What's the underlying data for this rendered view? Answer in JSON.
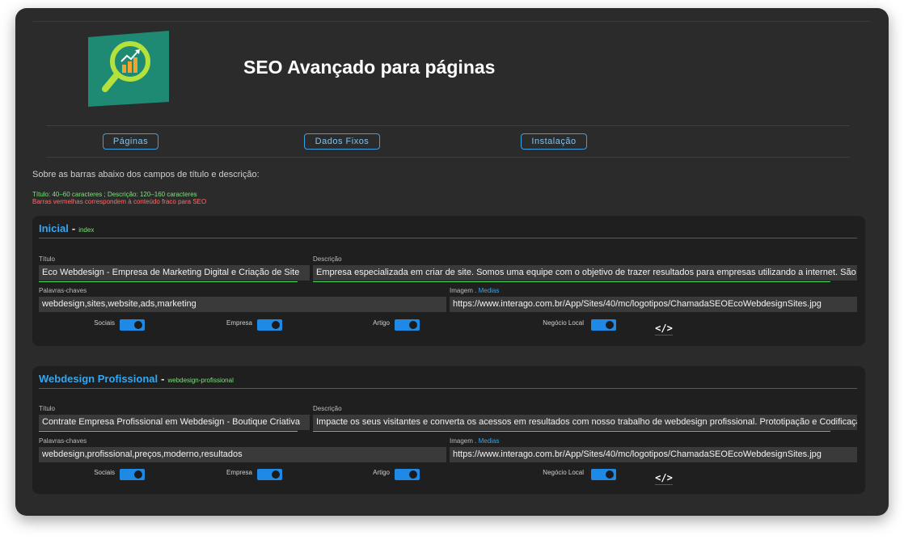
{
  "app": {
    "title": "SEO Avançado para páginas"
  },
  "nav": {
    "pages_label": "Páginas",
    "fixed_label": "Dados Fixos",
    "install_label": "Instalação"
  },
  "info": {
    "title": "Sobre as barras abaixo dos campos de título e descrição:",
    "green_note": "Título: 40–60 caracteres ; Descrição: 120–160 caracteres",
    "red_note": "Barras vermelhas correspondem à conteúdo fraco para SEO"
  },
  "labels": {
    "title": "Título",
    "description": "Descrição",
    "keywords": "Palavras-chaves",
    "image": "Imagem . ",
    "image_link": "Medias",
    "separator": "-",
    "social": "Sociais",
    "company": "Empresa",
    "article": "Artigo",
    "local": "Negócio Local",
    "code_icon": "</>"
  },
  "pages": [
    {
      "name": "Inicial",
      "slug": "index",
      "title": "Eco Webdesign - Empresa de Marketing Digital e Criação de Site",
      "description": "Empresa especializada em criar de site. Somos uma equipe com o objetivo de trazer resultados para empresas utilizando a internet. São",
      "keywords": "webdesign,sites,website,ads,marketing",
      "image": "https://www.interago.com.br/App/Sites/40/mc/logotipos/ChamadaSEOEcoWebdesignSites.jpg",
      "toggles": {
        "social": true,
        "company": true,
        "article": true,
        "local": true
      }
    },
    {
      "name": "Webdesign Profissional",
      "slug": "webdesign-profissional",
      "title": "Contrate Empresa Profissional em Webdesign - Boutique Criativa",
      "description": "Impacte os seus visitantes e converta os acessos em resultados com nosso trabalho de webdesign profissional. Prototipação e Codificação",
      "keywords": "webdesign,profissional,preços,moderno,resultados",
      "image": "https://www.interago.com.br/App/Sites/40/mc/logotipos/ChamadaSEOEcoWebdesignSites.jpg",
      "toggles": {
        "social": true,
        "company": true,
        "article": true,
        "local": true
      }
    }
  ],
  "colors": {
    "accent": "#34a7f2",
    "good_bar": "#4cd964",
    "warning": "#ff6b6b",
    "toggle_on": "#1e8ae6"
  }
}
